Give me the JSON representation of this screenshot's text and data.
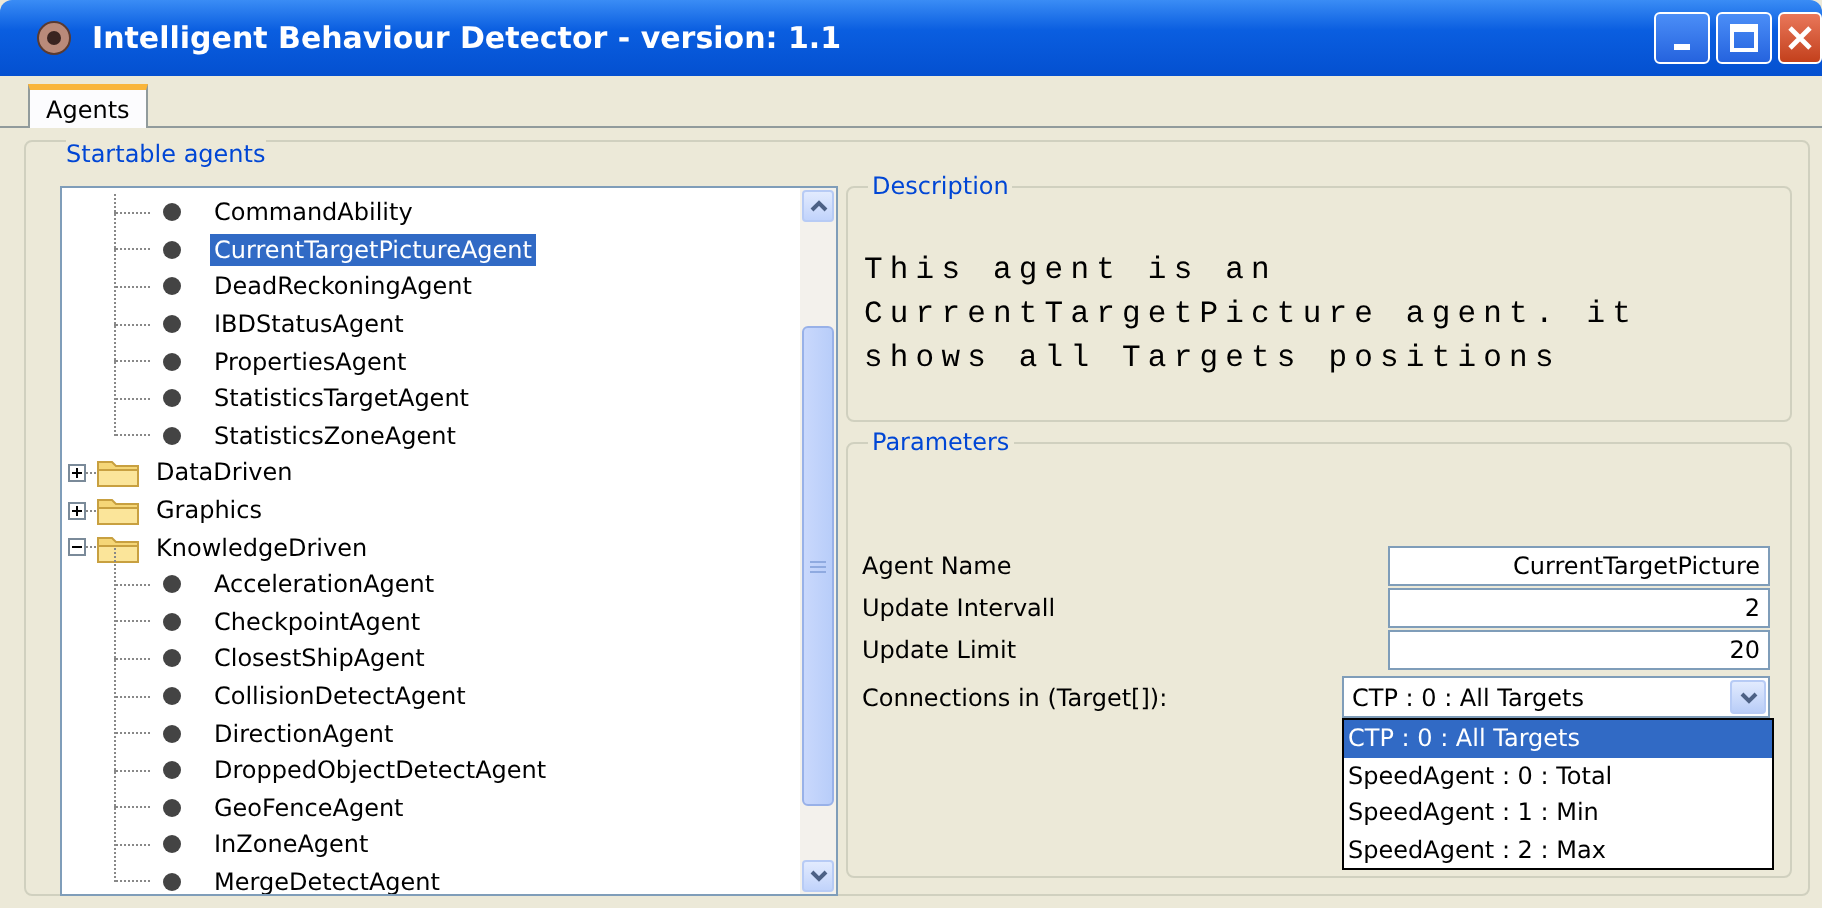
{
  "window": {
    "title": "Intelligent Behaviour Detector - version: 1.1"
  },
  "tabs": [
    {
      "label": "Agents",
      "selected": true
    }
  ],
  "group": {
    "title": "Startable agents"
  },
  "tree": {
    "items": [
      {
        "kind": "continued",
        "children": [
          {
            "kind": "leaf",
            "label": "CommandAbility",
            "selected": false
          },
          {
            "kind": "leaf",
            "label": "CurrentTargetPictureAgent",
            "selected": true
          },
          {
            "kind": "leaf",
            "label": "DeadReckoningAgent",
            "selected": false
          },
          {
            "kind": "leaf",
            "label": "IBDStatusAgent",
            "selected": false
          },
          {
            "kind": "leaf",
            "label": "PropertiesAgent",
            "selected": false
          },
          {
            "kind": "leaf",
            "label": "StatisticsTargetAgent",
            "selected": false
          },
          {
            "kind": "leaf",
            "label": "StatisticsZoneAgent",
            "selected": false
          }
        ]
      },
      {
        "kind": "folder",
        "label": "DataDriven",
        "expanded": false
      },
      {
        "kind": "folder",
        "label": "Graphics",
        "expanded": false
      },
      {
        "kind": "folder",
        "label": "KnowledgeDriven",
        "expanded": true,
        "children": [
          {
            "kind": "leaf",
            "label": "AccelerationAgent",
            "selected": false
          },
          {
            "kind": "leaf",
            "label": "CheckpointAgent",
            "selected": false
          },
          {
            "kind": "leaf",
            "label": "ClosestShipAgent",
            "selected": false
          },
          {
            "kind": "leaf",
            "label": "CollisionDetectAgent",
            "selected": false
          },
          {
            "kind": "leaf",
            "label": "DirectionAgent",
            "selected": false
          },
          {
            "kind": "leaf",
            "label": "DroppedObjectDetectAgent",
            "selected": false
          },
          {
            "kind": "leaf",
            "label": "GeoFenceAgent",
            "selected": false
          },
          {
            "kind": "leaf",
            "label": "InZoneAgent",
            "selected": false
          },
          {
            "kind": "leaf",
            "label": "MergeDetectAgent",
            "selected": false
          }
        ]
      }
    ]
  },
  "description": {
    "title": "Description",
    "text": "This agent is an CurrentTargetPicture agent. it shows all Targets positions"
  },
  "parameters": {
    "title": "Parameters",
    "fields": [
      {
        "kind": "text",
        "label": "Agent Name",
        "value": "CurrentTargetPicture"
      },
      {
        "kind": "text",
        "label": "Update Intervall",
        "value": "2"
      },
      {
        "kind": "text",
        "label": "Update Limit",
        "value": "20"
      },
      {
        "kind": "combo",
        "label": "Connections in (Target[]):",
        "value": "CTP : 0 : All Targets",
        "options": [
          {
            "label": "CTP : 0 : All Targets",
            "selected": true
          },
          {
            "label": "SpeedAgent : 0 : Total",
            "selected": false
          },
          {
            "label": "SpeedAgent : 1 : Min",
            "selected": false
          },
          {
            "label": "SpeedAgent : 2 : Max",
            "selected": false
          }
        ]
      }
    ]
  }
}
